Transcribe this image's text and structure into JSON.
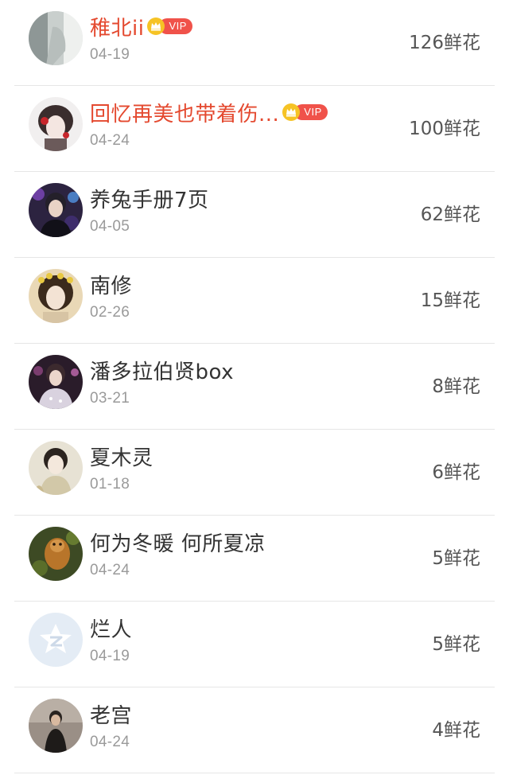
{
  "list": {
    "rows": [
      {
        "name": "稚北ii",
        "vip": true,
        "vip_label": "VIP",
        "date": "04-19",
        "flowers": "126鲜花",
        "avatar": "avatar-photo"
      },
      {
        "name": "回忆再美也带着伤...",
        "vip": true,
        "vip_label": "VIP",
        "date": "04-24",
        "flowers": "100鲜花",
        "avatar": "avatar-photo"
      },
      {
        "name": "养兔手册7页",
        "vip": false,
        "date": "04-05",
        "flowers": "62鲜花",
        "avatar": "avatar-photo"
      },
      {
        "name": "南修",
        "vip": false,
        "date": "02-26",
        "flowers": "15鲜花",
        "avatar": "avatar-photo"
      },
      {
        "name": "潘多拉伯贤box",
        "vip": false,
        "date": "03-21",
        "flowers": "8鲜花",
        "avatar": "avatar-photo"
      },
      {
        "name": "夏木灵",
        "vip": false,
        "date": "01-18",
        "flowers": "6鲜花",
        "avatar": "avatar-photo"
      },
      {
        "name": "何为冬暖 何所夏凉",
        "vip": false,
        "date": "04-24",
        "flowers": "5鲜花",
        "avatar": "avatar-photo"
      },
      {
        "name": "烂人",
        "vip": false,
        "date": "04-19",
        "flowers": "5鲜花",
        "avatar": "default-qzone-avatar-icon"
      },
      {
        "name": "老宫",
        "vip": false,
        "date": "04-24",
        "flowers": "4鲜花",
        "avatar": "avatar-photo"
      }
    ]
  },
  "colors": {
    "vip_name": "#e4492f",
    "vip_badge": "#f0524a",
    "crown": "#f4b400",
    "name": "#333333",
    "date": "#9a9a9a",
    "flowers": "#555555",
    "divider": "#e6e6e6"
  }
}
